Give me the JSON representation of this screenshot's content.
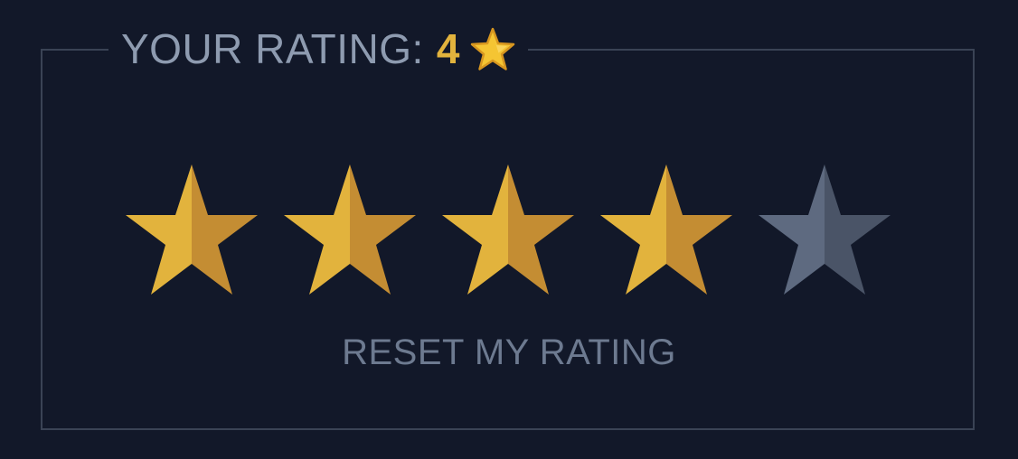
{
  "rating_widget": {
    "legend_label": "YOUR RATING:",
    "rating_value": "4",
    "legend_icon": "star-emoji-icon",
    "rating": 4,
    "max_rating": 5,
    "reset_label": "RESET MY RATING"
  },
  "colors": {
    "background": "#121829",
    "filled_star_light": "#e2b33d",
    "filled_star_dark": "#c48d33",
    "empty_star_light": "#5e6a80",
    "empty_star_dark": "#4a5467",
    "label_text": "#8e9bb0",
    "reset_text": "#6d7a90",
    "border": "#3a4355"
  }
}
